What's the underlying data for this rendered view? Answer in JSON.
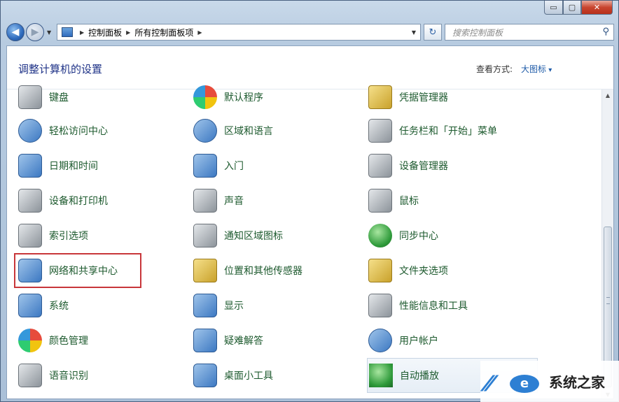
{
  "window": {
    "controls": {
      "minimize": "▭",
      "maximize": "▢",
      "close": "✕"
    }
  },
  "nav": {
    "back_icon": "arrow-left-icon",
    "forward_icon": "arrow-right-icon",
    "breadcrumb": [
      "控制面板",
      "所有控制面板项"
    ],
    "search_placeholder": "搜索控制面板"
  },
  "header": {
    "title": "调整计算机的设置",
    "view_by_label": "查看方式:",
    "view_by_value": "大图标"
  },
  "items": {
    "col1": [
      "键盘",
      "轻松访问中心",
      "日期和时间",
      "设备和打印机",
      "索引选项",
      "网络和共享中心",
      "系统",
      "颜色管理",
      "语音识别"
    ],
    "col2": [
      "默认程序",
      "区域和语言",
      "入门",
      "声音",
      "通知区域图标",
      "位置和其他传感器",
      "显示",
      "疑难解答",
      "桌面小工具"
    ],
    "col3": [
      "凭据管理器",
      "任务栏和「开始」菜单",
      "设备管理器",
      "鼠标",
      "同步中心",
      "文件夹选项",
      "性能信息和工具",
      "用户帐户",
      "自动播放"
    ]
  },
  "highlighted_item": "网络和共享中心",
  "watermark": {
    "text": "系统之家"
  },
  "colors": {
    "item_text": "#1d5a2e",
    "title": "#1e3287",
    "highlight": "#c8363a"
  }
}
